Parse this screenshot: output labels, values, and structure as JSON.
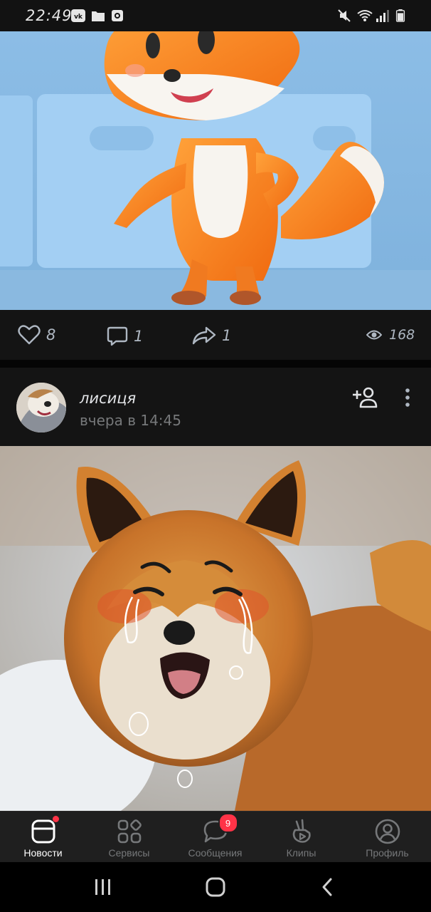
{
  "status_bar": {
    "time": "22:49",
    "icons": [
      "vk-icon",
      "folder-icon",
      "screenshot-icon",
      "mute-icon",
      "wifi-icon",
      "signal-icon",
      "battery-icon"
    ]
  },
  "post1": {
    "likes": "8",
    "comments": "1",
    "shares": "1",
    "views": "168"
  },
  "post2": {
    "author": "лисиця",
    "time": "вчера в 14:45"
  },
  "tabbar": {
    "tabs": [
      {
        "label": "Новости",
        "icon": "news-icon",
        "active": true
      },
      {
        "label": "Сервисы",
        "icon": "services-icon",
        "active": false
      },
      {
        "label": "Сообщения",
        "icon": "messages-icon",
        "active": false,
        "badge": "9"
      },
      {
        "label": "Клипы",
        "icon": "clips-icon",
        "active": false
      },
      {
        "label": "Профиль",
        "icon": "profile-icon",
        "active": false
      }
    ]
  },
  "colors": {
    "background": "#0a0a0a",
    "panel": "#141414",
    "tabbar": "#1f1f1f",
    "badge": "#ff3347",
    "muted_text": "#76787a",
    "icon": "#aeb7c2"
  }
}
